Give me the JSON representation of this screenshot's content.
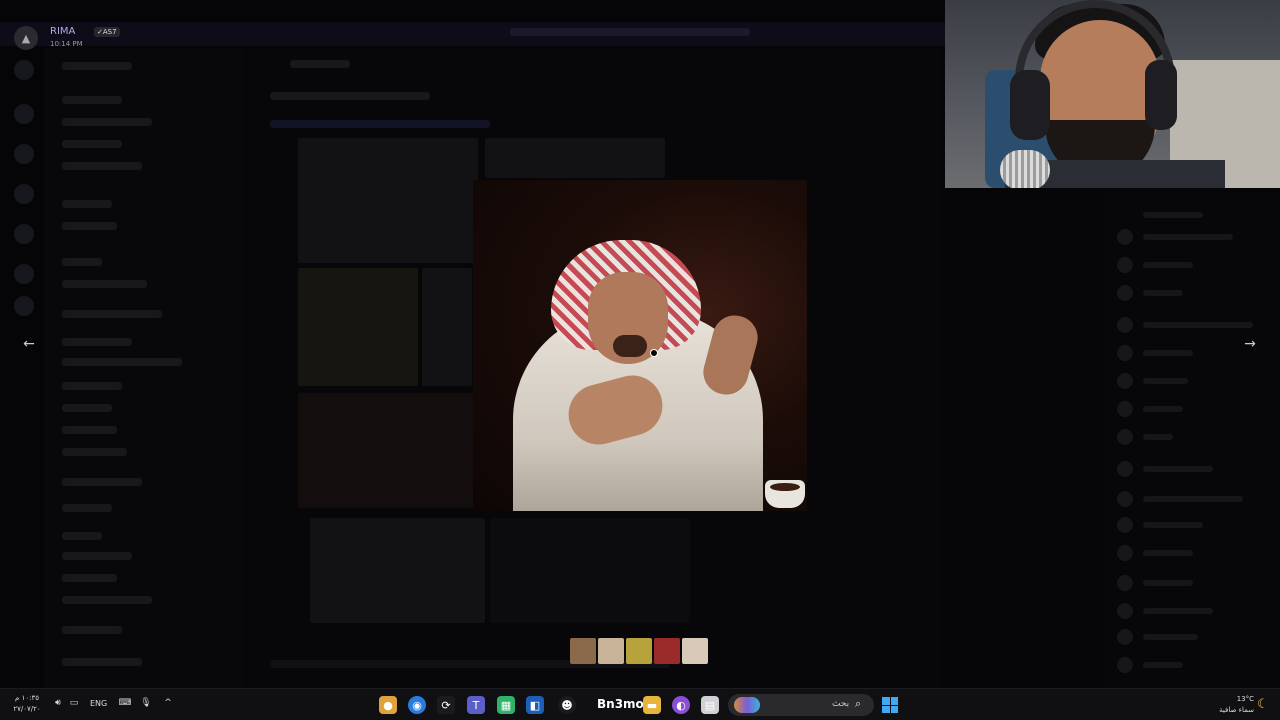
{
  "viewer_header": {
    "user_name": "RIMA",
    "user_tag": "✓AS7",
    "post_time": "10:14 PM"
  },
  "viewer": {
    "prev_icon": "arrow-left-icon",
    "next_icon": "arrow-right-icon"
  },
  "thumbnails": [
    {
      "name": "thumb-1",
      "color": "#8a6a4a"
    },
    {
      "name": "thumb-2",
      "color": "#c9b49a"
    },
    {
      "name": "thumb-3",
      "color": "#b7a23c"
    },
    {
      "name": "thumb-4",
      "color": "#9b2b2b"
    },
    {
      "name": "thumb-5",
      "color": "#d9c9b8"
    }
  ],
  "taskbar": {
    "clock_time": "١٠:٣٥ م",
    "clock_date": "٢٧/٠٧/٢٠",
    "language": "ENG",
    "app_label": "Bn3moo",
    "search_placeholder": "بحث",
    "weather_temp": "13°C",
    "weather_desc": "سماء صافية"
  },
  "colors": {
    "accent_name": "#b6a9e8",
    "windows_blue": "#3fa9f5"
  }
}
